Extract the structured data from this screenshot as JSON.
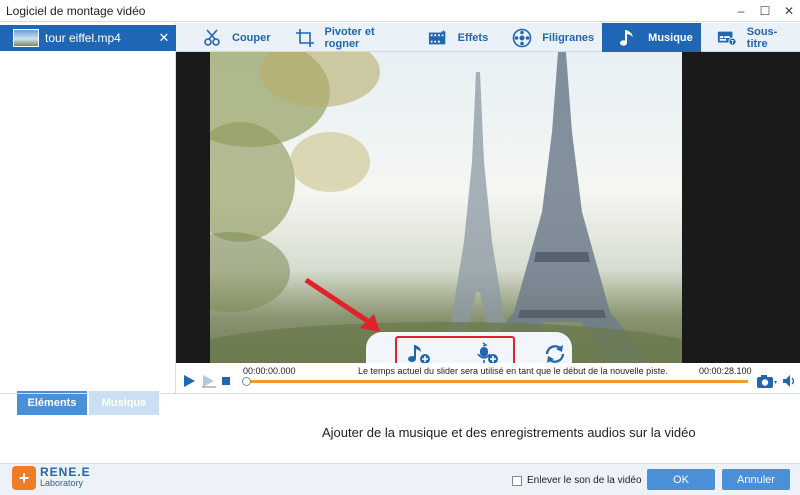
{
  "window": {
    "title": "Logiciel de montage vidéo",
    "minimize": "–",
    "maximize": "☐",
    "close": "✕"
  },
  "file": {
    "name": "tour eiffel.mp4",
    "close": "✕"
  },
  "left_tabs": [
    {
      "label": "Eléments"
    },
    {
      "label": "Musique"
    }
  ],
  "tabs": [
    {
      "label": "Couper",
      "icon": "scissors-icon"
    },
    {
      "label": "Pivoter et rogner",
      "icon": "crop-icon"
    },
    {
      "label": "Effets",
      "icon": "film-effects-icon"
    },
    {
      "label": "Filigranes",
      "icon": "watermark-icon"
    },
    {
      "label": "Musique",
      "icon": "music-note-icon",
      "active": true
    },
    {
      "label": "Sous-titre",
      "icon": "subtitle-icon"
    }
  ],
  "player": {
    "time_start": "00:00:00.000",
    "time_end": "00:00:28.100",
    "hint": "Le temps actuel du slider sera utilisé en tant que le début de la nouvelle piste."
  },
  "description": "Ajouter de la musique et des enregistrements audios sur la vidéo",
  "logo": {
    "line1": "RENE.E",
    "line2": "Laboratory",
    "badge": "+"
  },
  "mute_label": "Enlever le son de la vidéo",
  "buttons": {
    "ok": "OK",
    "cancel": "Annuler"
  },
  "colors": {
    "accent": "#1f66b5",
    "button": "#4a90d9",
    "timeline": "#f09b2a",
    "highlight": "#e0232a"
  }
}
